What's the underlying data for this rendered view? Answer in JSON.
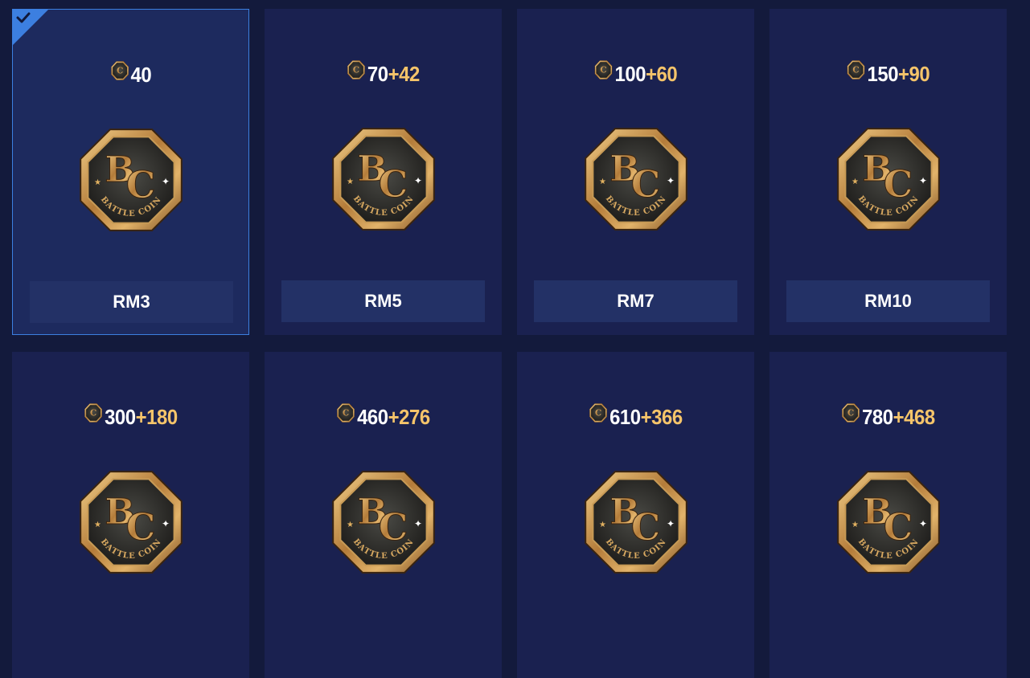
{
  "colors": {
    "page_bg": "#131a3c",
    "card_bg": "#1a2150",
    "selected_border": "#3c7fe0",
    "bonus_text": "#f5c46a",
    "price_button_bg": "#233166"
  },
  "icons": {
    "currency": "battle-coin-icon",
    "selected": "checkmark-icon"
  },
  "coin_art_text": {
    "monogram": "BC",
    "ring": "BATTLE COIN"
  },
  "packages": [
    {
      "base": "40",
      "bonus": "",
      "price": "RM3",
      "selected": true
    },
    {
      "base": "70",
      "bonus": "+42",
      "price": "RM5",
      "selected": false
    },
    {
      "base": "100",
      "bonus": "+60",
      "price": "RM7",
      "selected": false
    },
    {
      "base": "150",
      "bonus": "+90",
      "price": "RM10",
      "selected": false
    },
    {
      "base": "300",
      "bonus": "+180",
      "price": "",
      "selected": false
    },
    {
      "base": "460",
      "bonus": "+276",
      "price": "",
      "selected": false
    },
    {
      "base": "610",
      "bonus": "+366",
      "price": "",
      "selected": false
    },
    {
      "base": "780",
      "bonus": "+468",
      "price": "",
      "selected": false
    }
  ]
}
